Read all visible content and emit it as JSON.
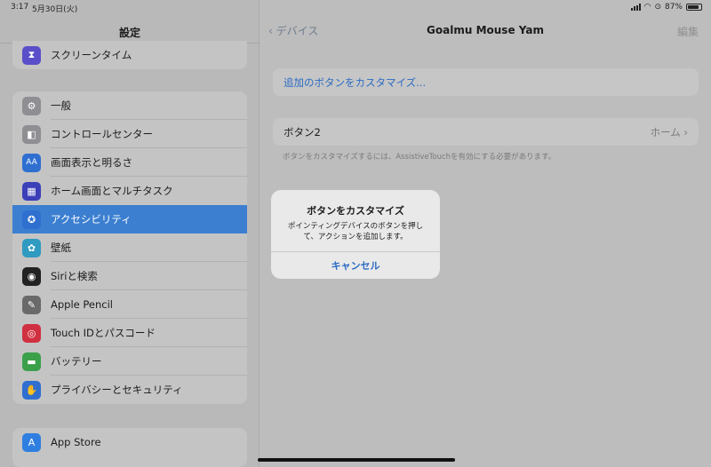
{
  "status": {
    "time": "3:17",
    "date": "5月30日(火)",
    "battery": "87%"
  },
  "sidebar": {
    "title": "設定",
    "top_item": {
      "label": "スクリーンタイム",
      "icon": "hourglass-icon",
      "color": "#5a4fc8"
    },
    "group1": [
      {
        "label": "一般",
        "icon": "gear-icon",
        "color": "#8e8e93",
        "glyph": "⚙"
      },
      {
        "label": "コントロールセンター",
        "icon": "toggles-icon",
        "color": "#8e8e93",
        "glyph": "◧"
      },
      {
        "label": "画面表示と明るさ",
        "icon": "display-aa-icon",
        "color": "#2f6fd0",
        "glyph": "AA"
      },
      {
        "label": "ホーム画面とマルチタスク",
        "icon": "home-grid-icon",
        "color": "#3b3fb8",
        "glyph": "▦"
      },
      {
        "label": "アクセシビリティ",
        "icon": "accessibility-icon",
        "color": "#2f6fd0",
        "glyph": "✪"
      },
      {
        "label": "壁紙",
        "icon": "wallpaper-flower-icon",
        "color": "#2f9bc0",
        "glyph": "✿"
      },
      {
        "label": "Siriと検索",
        "icon": "siri-icon",
        "color": "#222222",
        "glyph": "◉"
      },
      {
        "label": "Apple Pencil",
        "icon": "pencil-icon",
        "color": "#6a6a6a",
        "glyph": "✎"
      },
      {
        "label": "Touch IDとパスコード",
        "icon": "fingerprint-icon",
        "color": "#d03040",
        "glyph": "◎"
      },
      {
        "label": "バッテリー",
        "icon": "battery-icon",
        "color": "#3aa04a",
        "glyph": "▬"
      },
      {
        "label": "プライバシーとセキュリティ",
        "icon": "privacy-hand-icon",
        "color": "#2f6fd0",
        "glyph": "✋"
      }
    ],
    "group2": [
      {
        "label": "App Store",
        "icon": "app-store-icon",
        "color": "#2f7fe0",
        "glyph": "A"
      }
    ]
  },
  "detail": {
    "back_label": "デバイス",
    "title": "Goalmu Mouse Yam",
    "edit_label": "編集",
    "customize_link": "追加のボタンをカスタマイズ...",
    "button_row": {
      "label": "ボタン2",
      "value": "ホーム"
    },
    "note": "ボタンをカスタマイズするには、AssistiveTouchを有効にする必要があります。"
  },
  "alert": {
    "title": "ボタンをカスタマイズ",
    "message_line1": "ポインティングデバイスのボタンを押し",
    "message_line2": "て、アクションを追加します。",
    "cancel_label": "キャンセル"
  }
}
